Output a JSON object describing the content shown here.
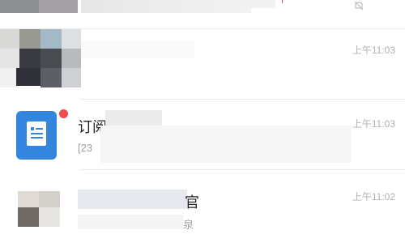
{
  "chat_list": {
    "row1": {
      "time": "上午11:03"
    },
    "row2": {
      "name": "订阅号消息",
      "name_visible": "订阅",
      "preview_prefix": "[23",
      "time": "上午11:03"
    },
    "row3": {
      "name_end": "官",
      "preview_end": "泉",
      "time": "上午11:02"
    }
  },
  "colors": {
    "accent_blue": "#3385dd",
    "unread_red": "#f04a4a",
    "time_gray": "#b2b2b2"
  },
  "icons": {
    "mute": "mute-bell-icon",
    "subscription": "document-icon"
  }
}
